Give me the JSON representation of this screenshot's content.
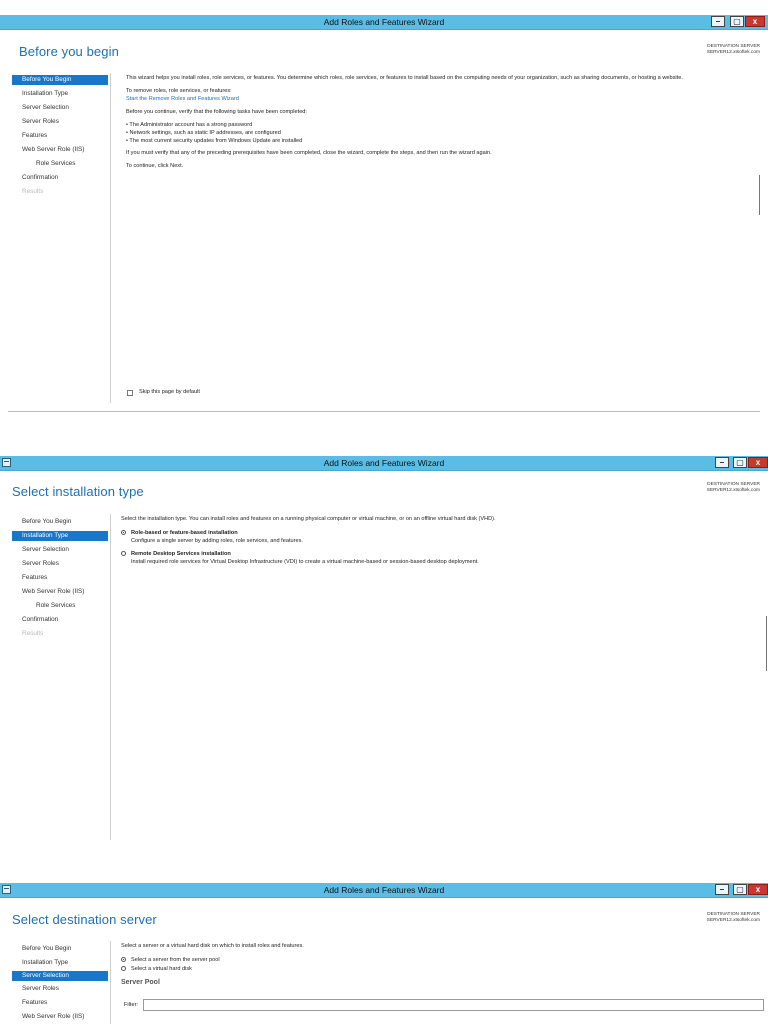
{
  "app_title": "Add Roles and Features Wizard",
  "window_controls": {
    "minimize": "–",
    "restore": "▢",
    "close": "x"
  },
  "destination": {
    "label": "DESTINATION SERVER",
    "server": "SERVER12.xtsoftek.com"
  },
  "nav_items": [
    "Before You Begin",
    "Installation Type",
    "Server Selection",
    "Server Roles",
    "Features",
    "Web Server Role (IIS)",
    "Role Services",
    "Confirmation",
    "Results"
  ],
  "screen1": {
    "title": "Before you begin",
    "intro": "This wizard helps you install roles, role services, or features. You determine which roles, role services, or features to install based on the computing needs of your organization, such as sharing documents, or hosting a website.",
    "remove_text": "To remove roles, role services, or features:",
    "remove_link": "Start the Remove Roles and Features Wizard",
    "verify_text": "Before you continue, verify that the following tasks have been completed:",
    "bullets": [
      "• The Administrator account has a strong password",
      "• Network settings, such as static IP addresses, are configured",
      "• The most current security updates from Windows Update are installed"
    ],
    "prereq_text": "If you must verify that any of the preceding prerequisites have been completed, close the wizard, complete the steps, and then run the wizard again.",
    "continue_text": "To continue, click Next.",
    "skip_label": "Skip this page by default"
  },
  "screen2": {
    "title": "Select installation type",
    "intro": "Select the installation type. You can install roles and features on a running physical computer or virtual machine, or on an offline virtual hard disk (VHD).",
    "option1_title": "Role-based or feature-based installation",
    "option1_desc": "Configure a single server by adding roles, role services, and features.",
    "option2_title": "Remote Desktop Services installation",
    "option2_desc": "Install required role services for Virtual Desktop Infrastructure (VDI) to create a virtual machine-based or session-based desktop deployment."
  },
  "screen3": {
    "title": "Select destination server",
    "intro": "Select a server or a virtual hard disk on which to install roles and features.",
    "option1": "Select a server from the server pool",
    "option2": "Select a virtual hard disk",
    "pool_label": "Server Pool",
    "filter_label": "Filter:"
  }
}
